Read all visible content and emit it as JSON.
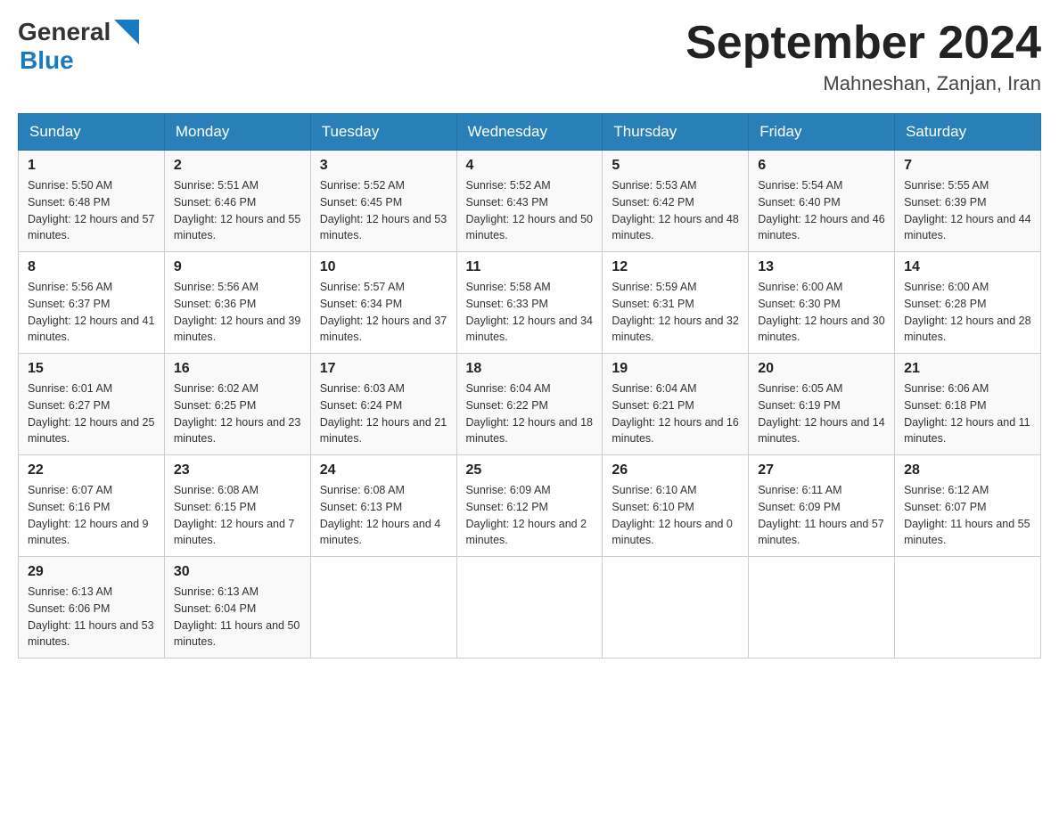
{
  "header": {
    "logo_general": "General",
    "logo_blue": "Blue",
    "month_year": "September 2024",
    "location": "Mahneshan, Zanjan, Iran"
  },
  "days_of_week": [
    "Sunday",
    "Monday",
    "Tuesday",
    "Wednesday",
    "Thursday",
    "Friday",
    "Saturday"
  ],
  "weeks": [
    [
      {
        "day": "1",
        "sunrise": "Sunrise: 5:50 AM",
        "sunset": "Sunset: 6:48 PM",
        "daylight": "Daylight: 12 hours and 57 minutes."
      },
      {
        "day": "2",
        "sunrise": "Sunrise: 5:51 AM",
        "sunset": "Sunset: 6:46 PM",
        "daylight": "Daylight: 12 hours and 55 minutes."
      },
      {
        "day": "3",
        "sunrise": "Sunrise: 5:52 AM",
        "sunset": "Sunset: 6:45 PM",
        "daylight": "Daylight: 12 hours and 53 minutes."
      },
      {
        "day": "4",
        "sunrise": "Sunrise: 5:52 AM",
        "sunset": "Sunset: 6:43 PM",
        "daylight": "Daylight: 12 hours and 50 minutes."
      },
      {
        "day": "5",
        "sunrise": "Sunrise: 5:53 AM",
        "sunset": "Sunset: 6:42 PM",
        "daylight": "Daylight: 12 hours and 48 minutes."
      },
      {
        "day": "6",
        "sunrise": "Sunrise: 5:54 AM",
        "sunset": "Sunset: 6:40 PM",
        "daylight": "Daylight: 12 hours and 46 minutes."
      },
      {
        "day": "7",
        "sunrise": "Sunrise: 5:55 AM",
        "sunset": "Sunset: 6:39 PM",
        "daylight": "Daylight: 12 hours and 44 minutes."
      }
    ],
    [
      {
        "day": "8",
        "sunrise": "Sunrise: 5:56 AM",
        "sunset": "Sunset: 6:37 PM",
        "daylight": "Daylight: 12 hours and 41 minutes."
      },
      {
        "day": "9",
        "sunrise": "Sunrise: 5:56 AM",
        "sunset": "Sunset: 6:36 PM",
        "daylight": "Daylight: 12 hours and 39 minutes."
      },
      {
        "day": "10",
        "sunrise": "Sunrise: 5:57 AM",
        "sunset": "Sunset: 6:34 PM",
        "daylight": "Daylight: 12 hours and 37 minutes."
      },
      {
        "day": "11",
        "sunrise": "Sunrise: 5:58 AM",
        "sunset": "Sunset: 6:33 PM",
        "daylight": "Daylight: 12 hours and 34 minutes."
      },
      {
        "day": "12",
        "sunrise": "Sunrise: 5:59 AM",
        "sunset": "Sunset: 6:31 PM",
        "daylight": "Daylight: 12 hours and 32 minutes."
      },
      {
        "day": "13",
        "sunrise": "Sunrise: 6:00 AM",
        "sunset": "Sunset: 6:30 PM",
        "daylight": "Daylight: 12 hours and 30 minutes."
      },
      {
        "day": "14",
        "sunrise": "Sunrise: 6:00 AM",
        "sunset": "Sunset: 6:28 PM",
        "daylight": "Daylight: 12 hours and 28 minutes."
      }
    ],
    [
      {
        "day": "15",
        "sunrise": "Sunrise: 6:01 AM",
        "sunset": "Sunset: 6:27 PM",
        "daylight": "Daylight: 12 hours and 25 minutes."
      },
      {
        "day": "16",
        "sunrise": "Sunrise: 6:02 AM",
        "sunset": "Sunset: 6:25 PM",
        "daylight": "Daylight: 12 hours and 23 minutes."
      },
      {
        "day": "17",
        "sunrise": "Sunrise: 6:03 AM",
        "sunset": "Sunset: 6:24 PM",
        "daylight": "Daylight: 12 hours and 21 minutes."
      },
      {
        "day": "18",
        "sunrise": "Sunrise: 6:04 AM",
        "sunset": "Sunset: 6:22 PM",
        "daylight": "Daylight: 12 hours and 18 minutes."
      },
      {
        "day": "19",
        "sunrise": "Sunrise: 6:04 AM",
        "sunset": "Sunset: 6:21 PM",
        "daylight": "Daylight: 12 hours and 16 minutes."
      },
      {
        "day": "20",
        "sunrise": "Sunrise: 6:05 AM",
        "sunset": "Sunset: 6:19 PM",
        "daylight": "Daylight: 12 hours and 14 minutes."
      },
      {
        "day": "21",
        "sunrise": "Sunrise: 6:06 AM",
        "sunset": "Sunset: 6:18 PM",
        "daylight": "Daylight: 12 hours and 11 minutes."
      }
    ],
    [
      {
        "day": "22",
        "sunrise": "Sunrise: 6:07 AM",
        "sunset": "Sunset: 6:16 PM",
        "daylight": "Daylight: 12 hours and 9 minutes."
      },
      {
        "day": "23",
        "sunrise": "Sunrise: 6:08 AM",
        "sunset": "Sunset: 6:15 PM",
        "daylight": "Daylight: 12 hours and 7 minutes."
      },
      {
        "day": "24",
        "sunrise": "Sunrise: 6:08 AM",
        "sunset": "Sunset: 6:13 PM",
        "daylight": "Daylight: 12 hours and 4 minutes."
      },
      {
        "day": "25",
        "sunrise": "Sunrise: 6:09 AM",
        "sunset": "Sunset: 6:12 PM",
        "daylight": "Daylight: 12 hours and 2 minutes."
      },
      {
        "day": "26",
        "sunrise": "Sunrise: 6:10 AM",
        "sunset": "Sunset: 6:10 PM",
        "daylight": "Daylight: 12 hours and 0 minutes."
      },
      {
        "day": "27",
        "sunrise": "Sunrise: 6:11 AM",
        "sunset": "Sunset: 6:09 PM",
        "daylight": "Daylight: 11 hours and 57 minutes."
      },
      {
        "day": "28",
        "sunrise": "Sunrise: 6:12 AM",
        "sunset": "Sunset: 6:07 PM",
        "daylight": "Daylight: 11 hours and 55 minutes."
      }
    ],
    [
      {
        "day": "29",
        "sunrise": "Sunrise: 6:13 AM",
        "sunset": "Sunset: 6:06 PM",
        "daylight": "Daylight: 11 hours and 53 minutes."
      },
      {
        "day": "30",
        "sunrise": "Sunrise: 6:13 AM",
        "sunset": "Sunset: 6:04 PM",
        "daylight": "Daylight: 11 hours and 50 minutes."
      },
      {
        "day": "",
        "sunrise": "",
        "sunset": "",
        "daylight": ""
      },
      {
        "day": "",
        "sunrise": "",
        "sunset": "",
        "daylight": ""
      },
      {
        "day": "",
        "sunrise": "",
        "sunset": "",
        "daylight": ""
      },
      {
        "day": "",
        "sunrise": "",
        "sunset": "",
        "daylight": ""
      },
      {
        "day": "",
        "sunrise": "",
        "sunset": "",
        "daylight": ""
      }
    ]
  ]
}
